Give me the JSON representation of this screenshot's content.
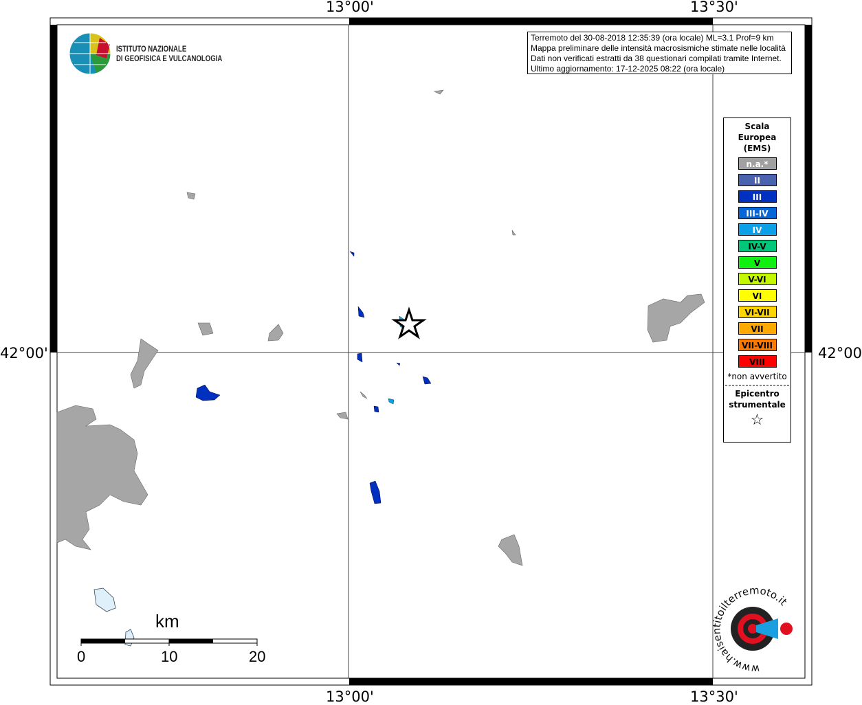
{
  "axes": {
    "lon_labels": [
      "13°00'",
      "13°30'"
    ],
    "lat_labels": [
      "42°00'"
    ]
  },
  "logo": {
    "line1": "ISTITUTO NAZIONALE",
    "line2": "DI GEOFISICA E VULCANOLOGIA"
  },
  "info": {
    "line1": "Terremoto del 30-08-2018 12:35:39 (ora locale) ML=3.1 Prof=9 km",
    "line2": "Mappa preliminare delle intensità macrosismiche stimate nelle località",
    "line3": "Dati non verificati estratti da 38 questionari compilati tramite Internet.",
    "line4": "Ultimo aggiornamento: 17-12-2025 08:22 (ora locale)"
  },
  "legend": {
    "title1": "Scala",
    "title2": "Europea",
    "title3": "(EMS)",
    "items": [
      {
        "label": "n.a.*",
        "color": "#a0a0a0",
        "text": "#fff"
      },
      {
        "label": "II",
        "color": "#4a63ae",
        "text": "#fff"
      },
      {
        "label": "III",
        "color": "#0030c0",
        "text": "#fff"
      },
      {
        "label": "III-IV",
        "color": "#0766d6",
        "text": "#fff"
      },
      {
        "label": "IV",
        "color": "#0ca0e8",
        "text": "#fff"
      },
      {
        "label": "IV-V",
        "color": "#00c77a",
        "text": "#000"
      },
      {
        "label": "V",
        "color": "#10f010",
        "text": "#000"
      },
      {
        "label": "V-VI",
        "color": "#c4f800",
        "text": "#000"
      },
      {
        "label": "VI",
        "color": "#ffff00",
        "text": "#000"
      },
      {
        "label": "VI-VII",
        "color": "#ffd400",
        "text": "#000"
      },
      {
        "label": "VII",
        "color": "#ffa800",
        "text": "#000"
      },
      {
        "label": "VII-VIII",
        "color": "#ff7800",
        "text": "#000"
      },
      {
        "label": "VIII",
        "color": "#ff0000",
        "text": "#000"
      }
    ],
    "note": "*non avvertito",
    "epicenter1": "Epicentro",
    "epicenter2": "strumentale"
  },
  "scalebar": {
    "unit": "km",
    "labels": [
      "0",
      "10",
      "20"
    ]
  },
  "brand": {
    "text": "www.haisentitoilterremoto.it"
  }
}
